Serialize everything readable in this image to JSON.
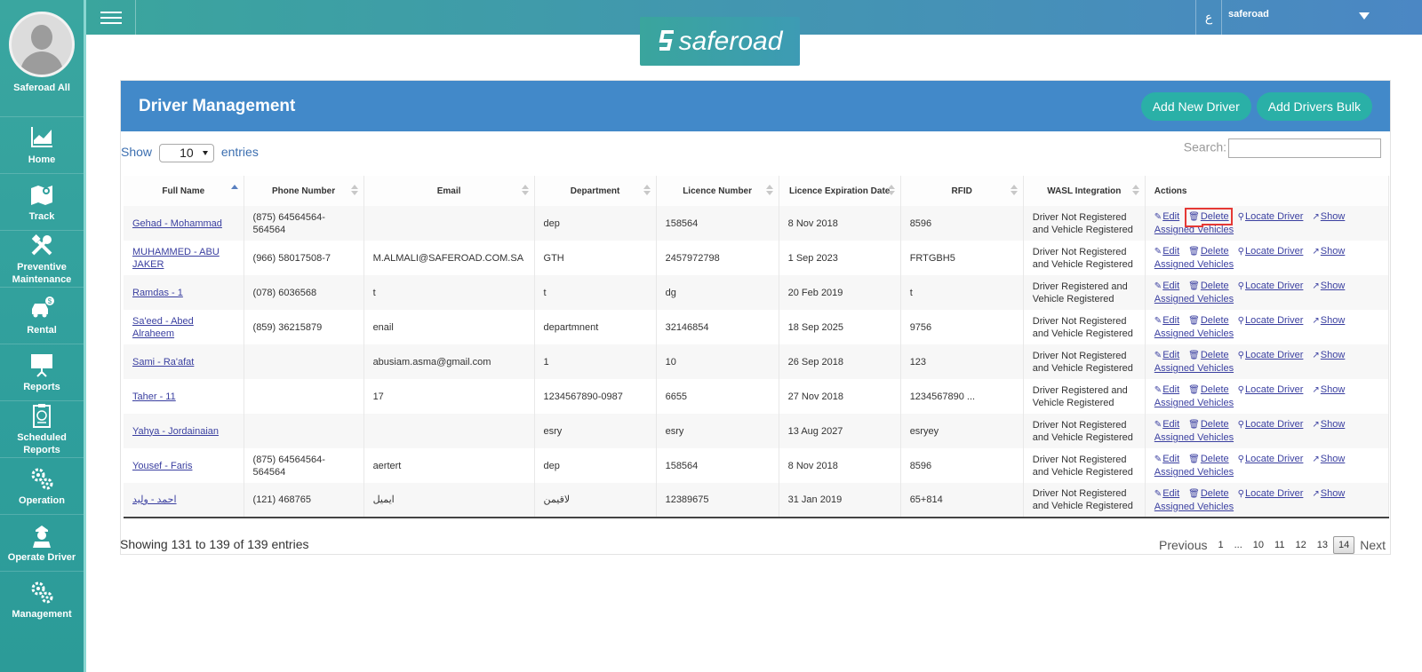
{
  "profile": {
    "name": "Saferoad All"
  },
  "sidebar": {
    "items": [
      {
        "label": "Home",
        "icon": "chart-icon"
      },
      {
        "label": "Track",
        "icon": "map-icon"
      },
      {
        "label": "Preventive Maintenance",
        "icon": "tools-icon"
      },
      {
        "label": "Rental",
        "icon": "car-icon"
      },
      {
        "label": "Reports",
        "icon": "presentation-icon"
      },
      {
        "label": "Scheduled Reports",
        "icon": "clipboard-icon"
      },
      {
        "label": "Operation",
        "icon": "gears-icon"
      },
      {
        "label": "Operate Driver",
        "icon": "driver-icon"
      },
      {
        "label": "Management",
        "icon": "gears-icon"
      }
    ]
  },
  "topbar": {
    "lang": "ع",
    "user": "saferoad",
    "logo": "saferoad"
  },
  "panel": {
    "title": "Driver Management",
    "add_driver": "Add New Driver",
    "add_bulk": "Add Drivers Bulk"
  },
  "controls": {
    "show": "Show",
    "entries_value": "10",
    "entries": "entries",
    "search": "Search:"
  },
  "table": {
    "headers": [
      "Full Name",
      "Phone Number",
      "Email",
      "Department",
      "Licence Number",
      "Licence Expiration Date",
      "RFID",
      "WASL Integration",
      "Actions"
    ],
    "actions": {
      "edit": "Edit",
      "delete": "Delete",
      "locate": "Locate Driver",
      "show_assigned": "Show Assigned Vehicles"
    },
    "rows": [
      [
        "Gehad - Mohammad",
        "(875) 64564564-564564",
        "",
        "dep",
        "158564",
        "8 Nov 2018",
        "8596",
        "Driver Not Registered and Vehicle Registered"
      ],
      [
        "MUHAMMED - ABU JAKER",
        "(966) 58017508-7",
        "M.ALMALI@SAFEROAD.COM.SA",
        "GTH",
        "2457972798",
        "1 Sep 2023",
        "FRTGBH5",
        "Driver Not Registered and Vehicle Registered"
      ],
      [
        "Ramdas - 1",
        "(078) 6036568",
        "t",
        "t",
        "dg",
        "20 Feb 2019",
        "t",
        "Driver Registered and Vehicle Registered"
      ],
      [
        "Sa'eed - Abed Alraheem",
        "(859) 36215879",
        "enail",
        "departmnent",
        "32146854",
        "18 Sep 2025",
        "9756",
        "Driver Not Registered and Vehicle Registered"
      ],
      [
        "Sami - Ra'afat",
        "",
        "abusiam.asma@gmail.com",
        "1",
        "10",
        "26 Sep 2018",
        "123",
        "Driver Not Registered and Vehicle Registered"
      ],
      [
        "Taher - 11",
        "",
        "17",
        "1234567890-0987",
        "6655",
        "27 Nov 2018",
        "1234567890 ...",
        "Driver Registered and Vehicle Registered"
      ],
      [
        "Yahya - Jordainaian",
        "",
        "",
        "esry",
        "esry",
        "13 Aug 2027",
        "esryey",
        "Driver Not Registered and Vehicle Registered"
      ],
      [
        "Yousef - Faris",
        "(875) 64564564-564564",
        "aertert",
        "dep",
        "158564",
        "8 Nov 2018",
        "8596",
        "Driver Not Registered and Vehicle Registered"
      ],
      [
        "احمد - وليد",
        "(121) 468765",
        "ايميل",
        "لاقيمن",
        "12389675",
        "31 Jan 2019",
        "65+814",
        "Driver Not Registered and Vehicle Registered"
      ]
    ]
  },
  "footer": {
    "info": "Showing 131 to 139 of 139 entries",
    "previous": "Previous",
    "pages": [
      "1",
      "...",
      "10",
      "11",
      "12",
      "13",
      "14"
    ],
    "active_page": "14",
    "next": "Next"
  },
  "colors": {
    "sidebar": "#2f9f9c",
    "header": "#4289c9",
    "button": "#2ab0a7",
    "link": "#3a3fa0",
    "highlight": "#e53935"
  }
}
